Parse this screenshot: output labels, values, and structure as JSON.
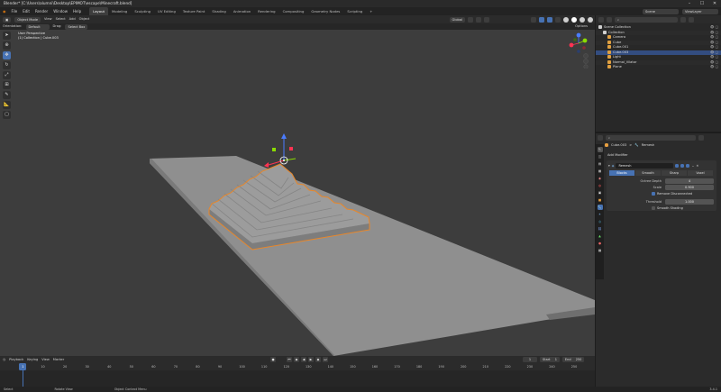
{
  "app": {
    "title": "Blender* [C:\\Users\\alumni\\Desktop\\EPIMOT\\escape\\Minecraft.blend]",
    "window_controls": [
      "–",
      "☐",
      "✕"
    ]
  },
  "menubar": {
    "menus": [
      "File",
      "Edit",
      "Render",
      "Window",
      "Help"
    ],
    "workspaces": [
      "Layout",
      "Modeling",
      "Sculpting",
      "UV Editing",
      "Texture Paint",
      "Shading",
      "Animation",
      "Rendering",
      "Compositing",
      "Geometry Nodes",
      "Scripting"
    ],
    "active_workspace": "Layout",
    "scene_label": "Scene",
    "view_layer_label": "ViewLayer"
  },
  "viewport_header": {
    "mode": "Object Mode",
    "menus": [
      "View",
      "Select",
      "Add",
      "Object"
    ],
    "orientation_label": "Orientation:",
    "orientation": "Default",
    "drag_label": "Drag:",
    "drag_value": "Select Box",
    "transform_pivot": "Global",
    "options": "Options"
  },
  "viewport_info": {
    "line1": "User Perspective",
    "line2": "(1) Collection | Cube.003"
  },
  "tools": [
    "cursor",
    "move",
    "rotate",
    "scale",
    "transform",
    "annotate",
    "measure",
    "add-cube"
  ],
  "outliner": {
    "header_label": "Scene Collection",
    "rows": [
      {
        "label": "Scene Collection",
        "indent": 0,
        "color": "#cfcfcf"
      },
      {
        "label": "Collection",
        "indent": 1,
        "color": "#cfcfcf"
      },
      {
        "label": "Camera",
        "indent": 2,
        "color": "#e0a040"
      },
      {
        "label": "Cube",
        "indent": 2,
        "color": "#e0a040"
      },
      {
        "label": "Cube.001",
        "indent": 2,
        "color": "#e0a040"
      },
      {
        "label": "Cube.003",
        "indent": 2,
        "color": "#e0a040",
        "selected": true
      },
      {
        "label": "Light",
        "indent": 2,
        "color": "#e0a040"
      },
      {
        "label": "Normal_Vilator",
        "indent": 2,
        "color": "#e0a040"
      },
      {
        "label": "Plane",
        "indent": 2,
        "color": "#e0a040"
      }
    ]
  },
  "properties": {
    "breadcrumb_object": "Cube.003",
    "breadcrumb_sep": ">",
    "breadcrumb_modifier": "Remesh",
    "add_modifier": "Add Modifier",
    "modifier_name": "Remesh",
    "modes": [
      "Blocks",
      "Smooth",
      "Sharp",
      "Voxel"
    ],
    "active_mode": "Blocks",
    "fields": [
      {
        "label": "Octree Depth",
        "value": "4"
      },
      {
        "label": "Scale",
        "value": "0.900"
      }
    ],
    "remove_disconnected": "Remove Disconnected",
    "threshold_label": "Threshold",
    "threshold_value": "1.000",
    "smooth_shading": "Smooth Shading"
  },
  "timeline": {
    "menus": [
      "Playback",
      "Keying",
      "View",
      "Marker"
    ],
    "current_frame": "1",
    "start_label": "Start",
    "start": "1",
    "end_label": "End",
    "end": "250",
    "ticks": [
      "0",
      "10",
      "20",
      "30",
      "40",
      "50",
      "60",
      "70",
      "80",
      "90",
      "100",
      "110",
      "120",
      "130",
      "140",
      "150",
      "160",
      "170",
      "180",
      "190",
      "200",
      "210",
      "220",
      "230",
      "240",
      "250"
    ]
  },
  "statusbar": {
    "items": [
      "Select",
      "Rotate View",
      "Object Context Menu"
    ],
    "version": "3.4.1"
  },
  "colors": {
    "accent": "#4772b3",
    "selection_outline": "#e8872a",
    "viewport_bg": "#3d3d3d"
  }
}
